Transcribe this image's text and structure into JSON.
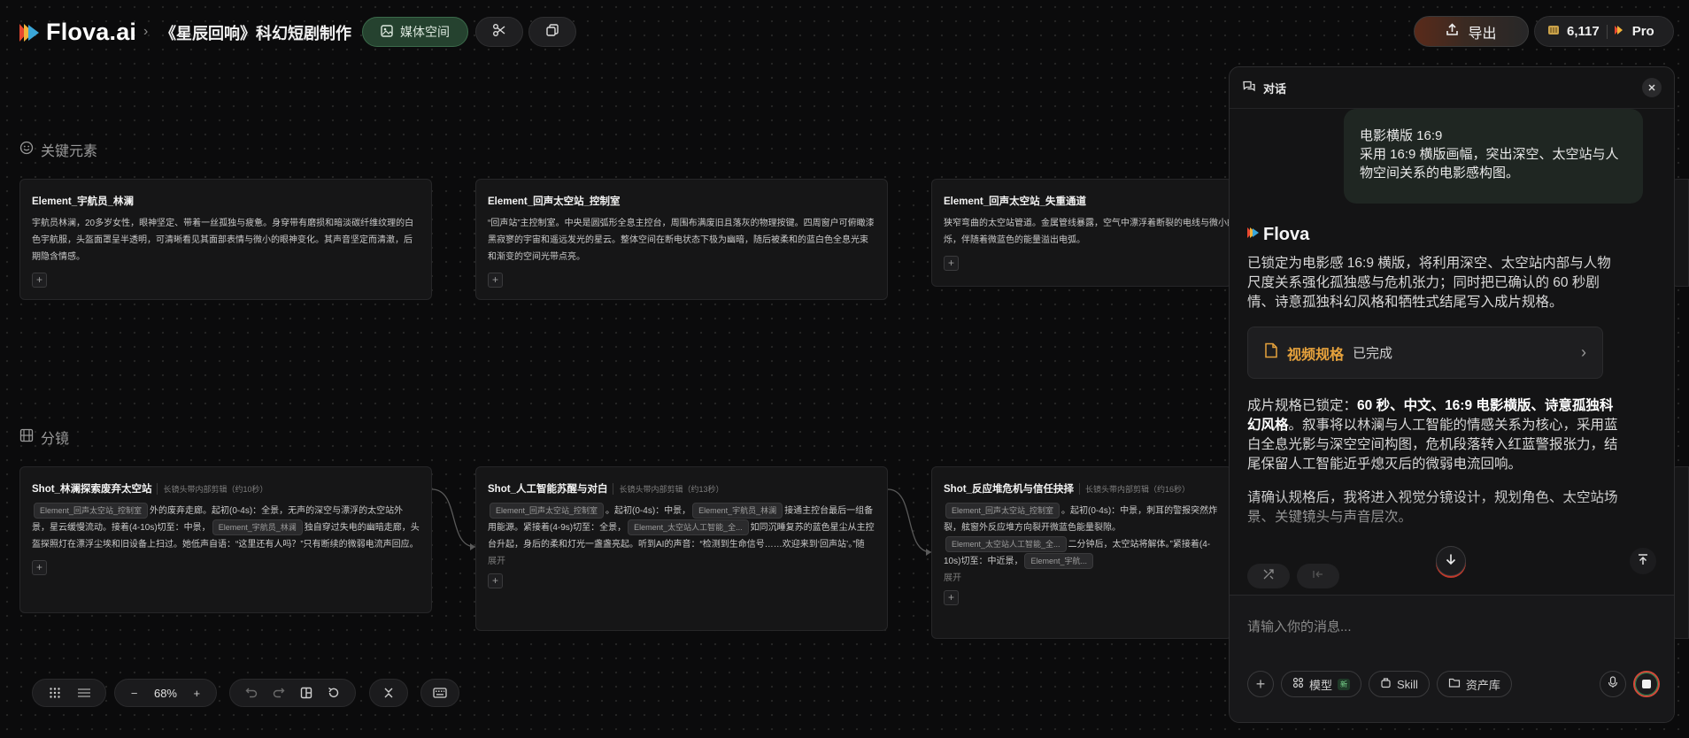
{
  "header": {
    "logo_text": "Flova.ai",
    "breadcrumb_sep": "›",
    "project_title": "《星辰回响》科幻短剧制作",
    "media_button": "媒体空间",
    "export_button": "导出",
    "credits": "6,117",
    "plan": "Pro"
  },
  "sections": {
    "elements_label": "关键元素",
    "shots_label": "分镜"
  },
  "element_cards": [
    {
      "title": "Element_宇航员_林澜",
      "body": "宇航员林澜，20多岁女性，眼神坚定、带着一丝孤独与疲惫。身穿带有磨损和暗淡碳纤维纹理的白色宇航服，头盔面罩呈半透明，可清晰看见其面部表情与微小的眼神变化。其声音坚定而清澈，后期隐含情感。"
    },
    {
      "title": "Element_回声太空站_控制室",
      "body": "“回声站”主控制室。中央是圆弧形全息主控台，周围布满废旧且落灰的物理按键。四周窗户可俯瞰漆黑寂寥的宇宙和遥远发光的星云。整体空间在断电状态下极为幽暗，随后被柔和的蓝白色全息光束和渐变的空间光带点亮。"
    },
    {
      "title": "Element_回声太空站_失重通道",
      "body": "狭窄弯曲的太空站管道。金属管线暴露，空气中漂浮着断裂的电线与微小的碎屑，红蓝警示灯交错闪烁，伴随着微蓝色的能量溢出电弧。"
    }
  ],
  "shot_cards": [
    {
      "title": "Shot_林澜探索废弃太空站",
      "sub": "长镜头带内部剪辑（约10秒）",
      "chip1": "Element_回声太空站_控制室",
      "t1": "外的废弃走廊。起初(0-4s)：全景，无声的深空与漂浮的太空站外景，星云缓慢流动。接着(4-10s)切至：中景，",
      "chip2": "Element_宇航员_林澜",
      "t2": "独自穿过失电的幽暗走廊，头盔探照灯在漂浮尘埃和旧设备上扫过。她低声自语：“这里还有人吗？”只有断续的微弱电流声回应。"
    },
    {
      "title": "Shot_人工智能苏醒与对白",
      "sub": "长镜头带内部剪辑（约13秒）",
      "chip1": "Element_回声太空站_控制室",
      "t1": "。起初(0-4s)：中景，",
      "chip2": "Element_宇航员_林澜",
      "t2": "接通主控台最后一组备用能源。紧接着(4-9s)切至：全景，",
      "chip3": "Element_太空站人工智能_全...",
      "t3": "如同沉睡复苏的蓝色星尘从主控台升起，身后的柔和灯光一盏盏亮起。听到AI的声音：“检测到生命信号……欢迎来到‘回声站’。”随",
      "expand": "展开"
    },
    {
      "title": "Shot_反应堆危机与信任抉择",
      "sub": "长镜头带内部剪辑（约16秒）",
      "chip1": "Element_回声太空站_控制室",
      "t1": "。起初(0-4s)：中景，刺耳的警报突然炸裂，舷窗外反应堆方向裂开微蓝色能量裂隙。",
      "chip2": "Element_太空站人工智能_全...",
      "t2": "二分钟后，太空站将解体。”紧接着(4-10s)切至：中近景，",
      "chip3": "Element_宇航...",
      "expand": "展开"
    }
  ],
  "toolbar": {
    "zoom": "68%",
    "zoom_out": "−",
    "zoom_in": "+"
  },
  "chat": {
    "title": "对话",
    "user_message_title": "电影横版 16:9",
    "user_message_body": "采用 16:9 横版画幅，突出深空、太空站与人物空间关系的电影感构图。",
    "assistant_name": "Flova",
    "para1": "已锁定为电影感 16:9 横版，将利用深空、太空站内部与人物尺度关系强化孤独感与危机张力；同时把已确认的 60 秒剧情、诗意孤独科幻风格和牺牲式结尾写入成片规格。",
    "spec_title": "视频规格",
    "spec_status": "已完成",
    "para2_prefix": "成片规格已锁定：",
    "para2_bold": "60 秒、中文、16:9 电影横版、诗意孤独科幻风格",
    "para2_rest": "。叙事将以林澜与人工智能的情感关系为核心，采用蓝白全息光影与深空空间构图，危机段落转入红蓝警报张力，结尾保留人工智能近乎熄灭后的微弱电流回响。",
    "para3": "请确认规格后，我将进入视觉分镜设计，规划角色、太空站场景、关键镜头与声音层次。",
    "input_placeholder": "请输入你的消息...",
    "model_label": "模型",
    "model_badge": "新",
    "skill_label": "Skill",
    "assets_label": "资产库"
  },
  "colors": {
    "accent_green": "#25422f",
    "spec_orange": "#e6a23c",
    "stop_red": "#d24a3a"
  }
}
